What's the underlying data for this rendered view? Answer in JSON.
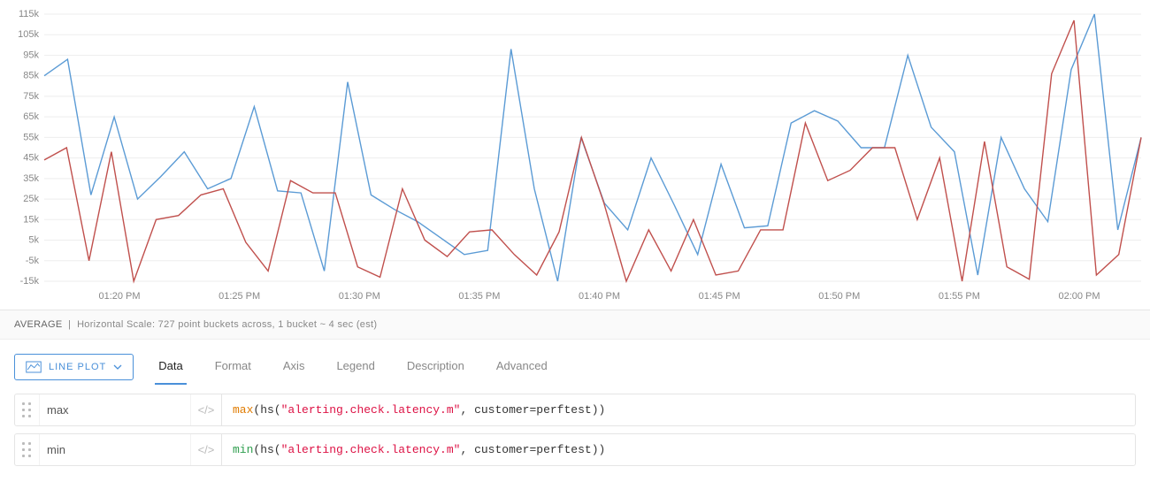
{
  "chart_data": {
    "type": "line",
    "xlabel": "",
    "ylabel": "",
    "ylim": [
      -15000,
      115000
    ],
    "xticks": [
      "01:20 PM",
      "01:25 PM",
      "01:30 PM",
      "01:35 PM",
      "01:40 PM",
      "01:45 PM",
      "01:50 PM",
      "01:55 PM",
      "02:00 PM"
    ],
    "yticks": [
      "115k",
      "105k",
      "95k",
      "85k",
      "75k",
      "65k",
      "55k",
      "45k",
      "35k",
      "25k",
      "15k",
      "5k",
      "-5k",
      "-15k"
    ],
    "ytick_vals": [
      115000,
      105000,
      95000,
      85000,
      75000,
      65000,
      55000,
      45000,
      35000,
      25000,
      15000,
      5000,
      -5000,
      -15000
    ],
    "series": [
      {
        "name": "max",
        "color": "#5b9bd5",
        "values": [
          85000,
          93000,
          27000,
          65000,
          25000,
          36000,
          48000,
          30000,
          35000,
          70000,
          29000,
          28000,
          -10000,
          82000,
          27000,
          20000,
          14000,
          6000,
          -2000,
          0,
          98000,
          30000,
          -15000,
          55000,
          23000,
          10000,
          45000,
          22000,
          -2000,
          42000,
          11000,
          12000,
          62000,
          68000,
          63000,
          50000,
          50000,
          95000,
          60000,
          48000,
          -12000,
          55000,
          30000,
          14000,
          88000,
          115000,
          10000,
          55000
        ]
      },
      {
        "name": "min",
        "color": "#c0504d",
        "values": [
          44000,
          50000,
          -5000,
          48000,
          -15000,
          15000,
          17000,
          27000,
          30000,
          4000,
          -10000,
          34000,
          28000,
          28000,
          -8000,
          -13000,
          30000,
          5000,
          -3000,
          9000,
          10000,
          -2000,
          -12000,
          9000,
          55000,
          23000,
          -15000,
          10000,
          -10000,
          15000,
          -12000,
          -10000,
          10000,
          10000,
          62000,
          34000,
          39000,
          50000,
          50000,
          15000,
          45000,
          -15000,
          53000,
          -8000,
          -14000,
          86000,
          112000,
          -12000,
          -2000,
          55000
        ]
      }
    ]
  },
  "footer": {
    "agg": "AVERAGE",
    "scale_text": "Horizontal Scale: 727 point buckets across, 1 bucket ~ 4 sec (est)"
  },
  "plot_button": {
    "label": "LINE PLOT"
  },
  "tabs": [
    "Data",
    "Format",
    "Axis",
    "Legend",
    "Description",
    "Advanced"
  ],
  "active_tab": "Data",
  "queries": [
    {
      "name": "max",
      "fn": "max",
      "fn_class": "tok-fn-max",
      "inner_prefix": "(hs(",
      "str": "\"alerting.check.latency.m\"",
      "inner_suffix": ", customer=perftest))"
    },
    {
      "name": "min",
      "fn": "min",
      "fn_class": "tok-fn-min",
      "inner_prefix": "(hs(",
      "str": "\"alerting.check.latency.m\"",
      "inner_suffix": ", customer=perftest))"
    }
  ]
}
